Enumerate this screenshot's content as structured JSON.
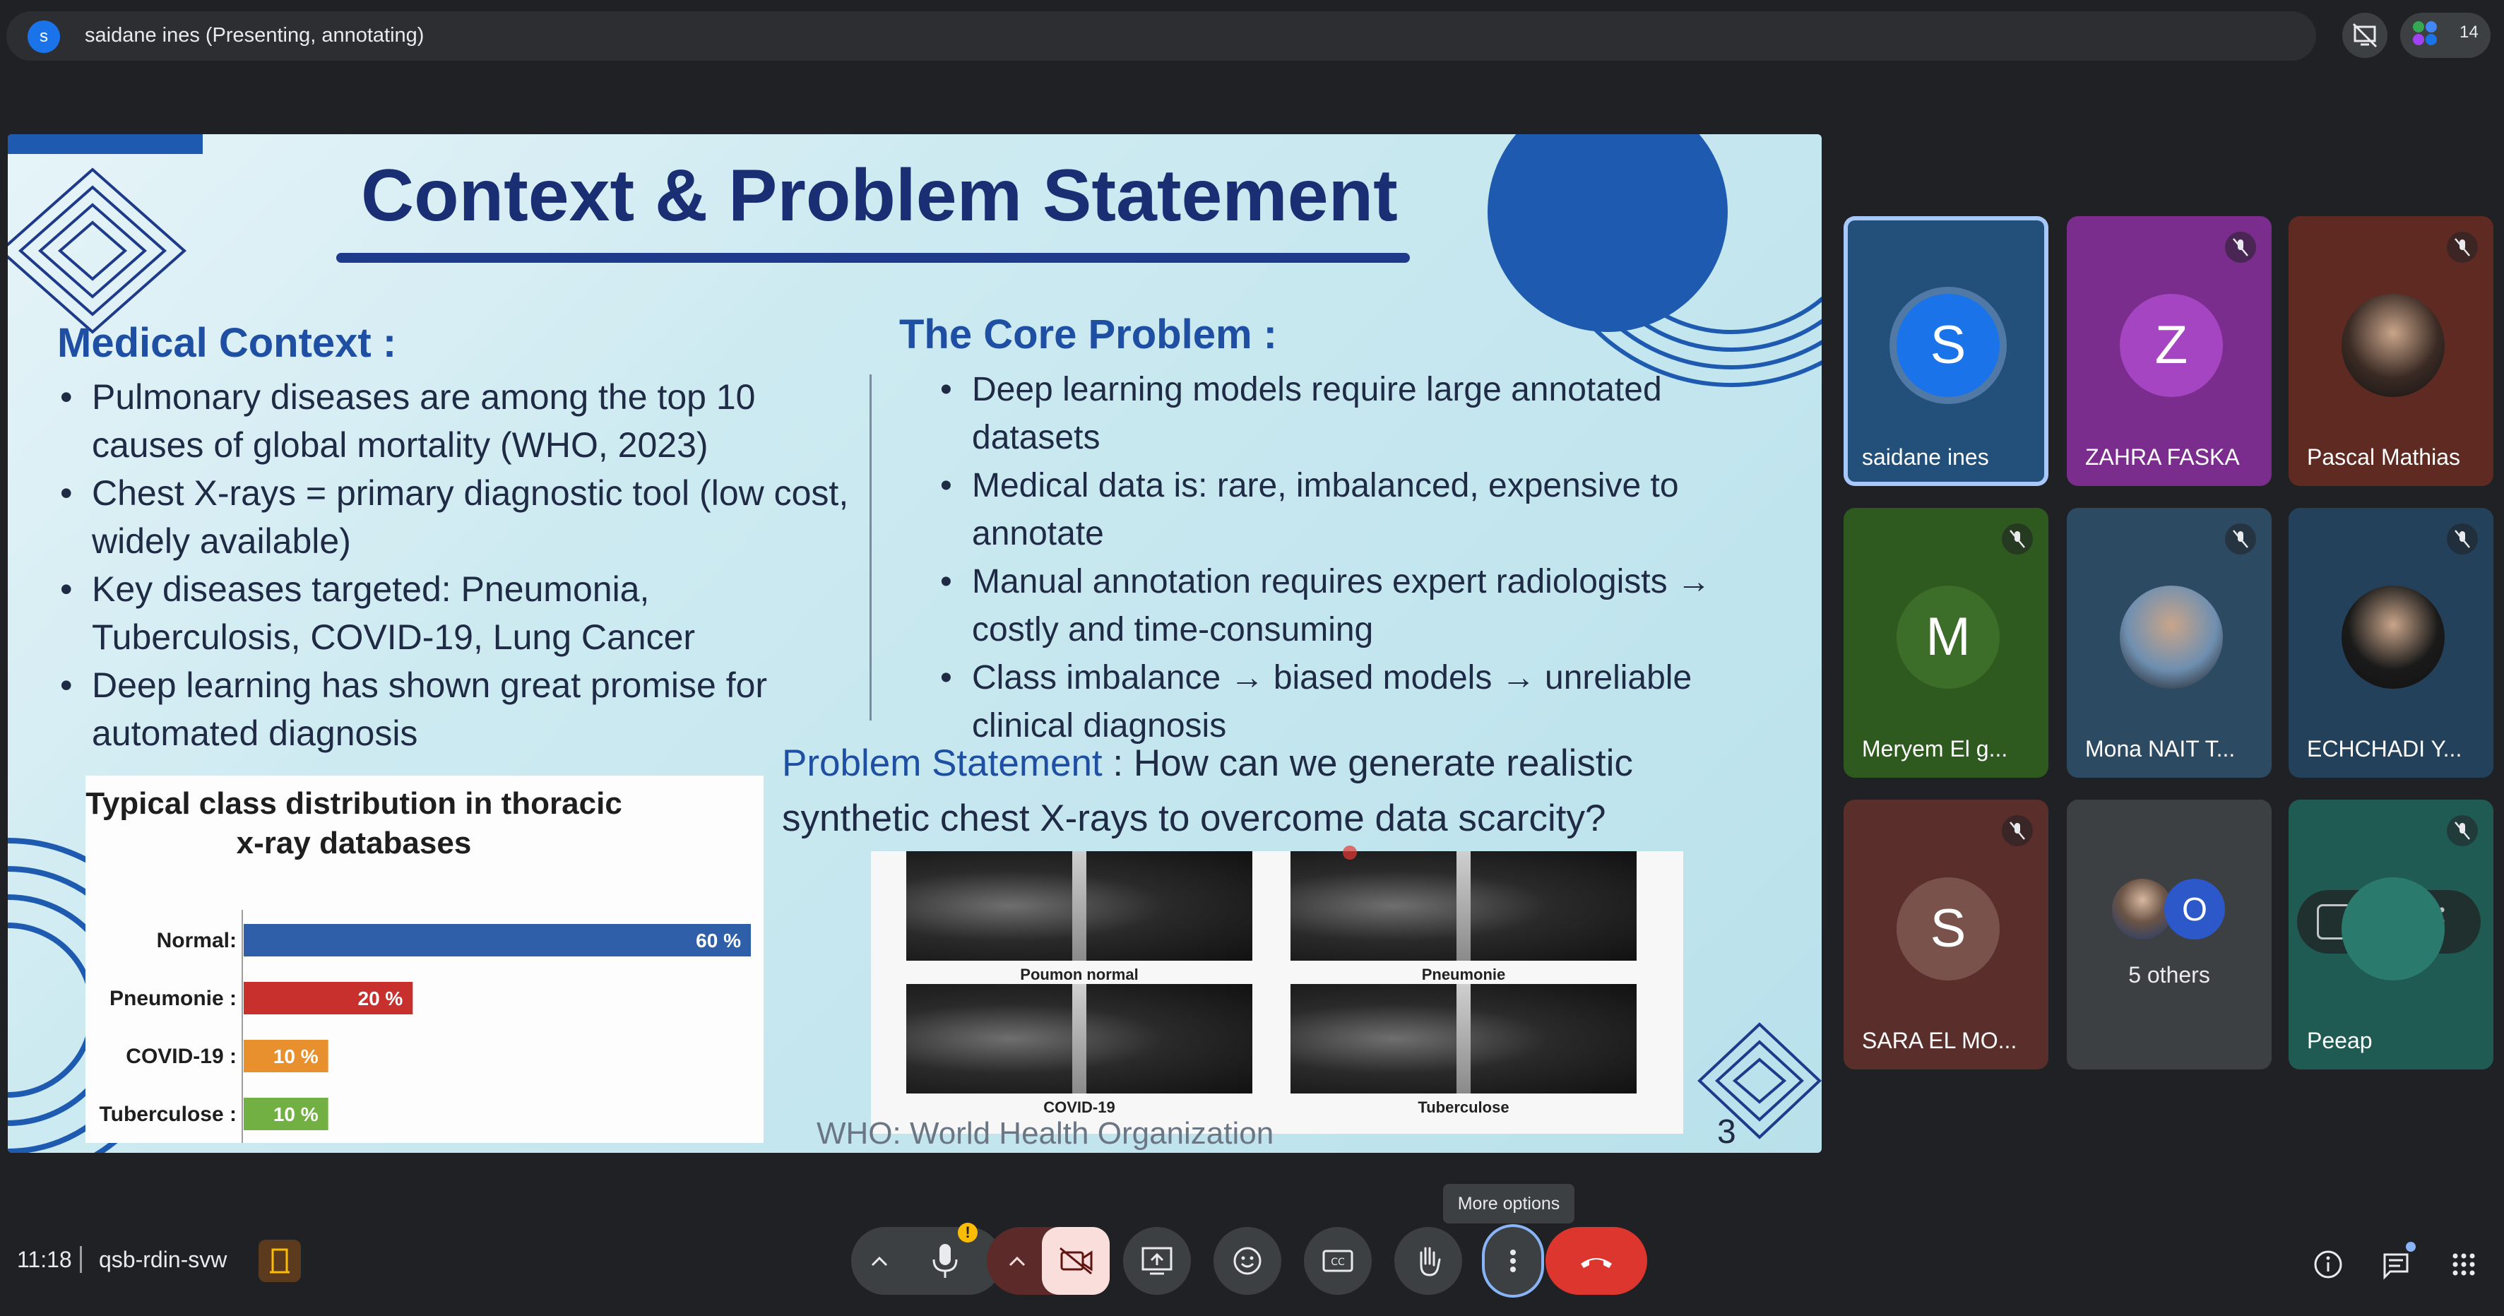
{
  "topbar": {
    "presenter_initial": "s",
    "presenter_label": "saidane ines (Presenting, annotating)",
    "participant_count": "14"
  },
  "slide": {
    "title": "Context & Problem Statement",
    "left_heading": "Medical Context :",
    "left_bullets": [
      "Pulmonary diseases are among the top 10 causes of global mortality (WHO, 2023)",
      "Chest X-rays = primary diagnostic tool (low cost, widely available)",
      "Key diseases targeted: Pneumonia, Tuberculosis, COVID-19, Lung Cancer",
      "Deep learning has shown great promise for automated diagnosis"
    ],
    "right_heading": "The Core Problem :",
    "right_bullets": [
      "Deep learning models require large annotated datasets",
      "Medical data is: rare, imbalanced, expensive to annotate",
      "Manual annotation requires expert radiologists → costly and time-consuming",
      "Class imbalance → biased models → unreliable clinical diagnosis"
    ],
    "problem_label": "Problem Statement",
    "problem_text": ": How can we generate realistic synthetic chest X-rays to overcome data scarcity?",
    "xray_labels": [
      "Poumon normal",
      "Pneumonie",
      "COVID-19",
      "Tuberculose"
    ],
    "footnote": "WHO: World Health Organization",
    "page_number": "3"
  },
  "chart_data": {
    "type": "bar",
    "orientation": "horizontal",
    "title": "Typical class distribution in thoracic x-ray databases",
    "categories": [
      "Normal:",
      "Pneumonie :",
      "COVID-19 :",
      "Tuberculose :"
    ],
    "values": [
      60,
      20,
      10,
      10
    ],
    "value_labels": [
      "60 %",
      "20 %",
      "10 %",
      "10 %"
    ],
    "colors": [
      "#2f5fa8",
      "#c8302d",
      "#e8902e",
      "#72b043"
    ],
    "xlim": [
      0,
      60
    ],
    "grid": false
  },
  "participants": [
    {
      "name": "saidane ines",
      "initial": "S",
      "bg": "#23507a",
      "avatar_bg": "#1a73e8",
      "muted": false,
      "active": true,
      "kind": "initial"
    },
    {
      "name": "ZAHRA FASKA",
      "initial": "Z",
      "bg": "#7b2d8e",
      "avatar_bg": "#a545c2",
      "muted": true,
      "active": false,
      "kind": "initial"
    },
    {
      "name": "Pascal Mathias",
      "initial": "",
      "bg": "#5e2a22",
      "avatar_bg": "#3a2a24",
      "muted": true,
      "active": false,
      "kind": "photo"
    },
    {
      "name": "Meryem El g...",
      "initial": "M",
      "bg": "#2e5a1f",
      "avatar_bg": "#3d6e29",
      "muted": true,
      "active": false,
      "kind": "initial"
    },
    {
      "name": "Mona NAIT T...",
      "initial": "",
      "bg": "#2d4a63",
      "avatar_bg": "#6f8fb0",
      "muted": true,
      "active": false,
      "kind": "photo"
    },
    {
      "name": "ECHCHADI Y...",
      "initial": "",
      "bg": "#23415a",
      "avatar_bg": "#1a1a1a",
      "muted": true,
      "active": false,
      "kind": "photo"
    },
    {
      "name": "SARA EL MO...",
      "initial": "S",
      "bg": "#5a2e2a",
      "avatar_bg": "#7a524c",
      "muted": true,
      "active": false,
      "kind": "initial"
    },
    {
      "name": "Peeap",
      "initial": "",
      "bg": "#1f5b52",
      "avatar_bg": "#2b7a6e",
      "muted": true,
      "active": false,
      "kind": "hover"
    }
  ],
  "others": {
    "label": "5 others",
    "initial": "O"
  },
  "bottom": {
    "time": "11:18",
    "meeting_code": "qsb-rdin-svw",
    "tooltip": "More options"
  }
}
